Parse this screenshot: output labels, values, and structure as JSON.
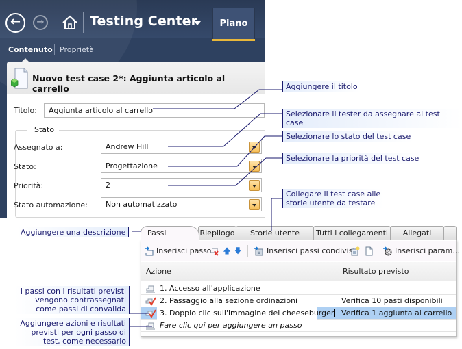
{
  "header": {
    "app_title": "Testing Center",
    "active_tab": "Piano",
    "subnav": {
      "active": "Contenuto",
      "inactive": "Proprietà"
    }
  },
  "work_item": {
    "title": "Nuovo test case 2*: Aggiunta articolo al carrello",
    "title_label": "Titolo:",
    "title_value": "Aggiunta articolo al carrello",
    "group_label": "Stato",
    "fields": [
      {
        "label": "Assegnato a:",
        "value": "Andrew Hill"
      },
      {
        "label": "Stato:",
        "value": "Progettazione"
      },
      {
        "label": "Priorità:",
        "value": "2"
      },
      {
        "label": "Stato automazione:",
        "value": "Non automatizzato"
      }
    ]
  },
  "steps_panel": {
    "tabs": [
      "Passi",
      "Riepilogo",
      "Storie utente testate",
      "Tutti i collegamenti",
      "Allegati",
      ""
    ],
    "active_tab": "Passi",
    "toolbar": {
      "insert_step": "Inserisci passo",
      "insert_shared_steps": "Inserisci passi condivisi",
      "insert_parameter": "Inserisci param..."
    },
    "columns": [
      "Azione",
      "Risultato previsto"
    ],
    "rows": [
      {
        "action": "1. Accesso all'applicazione",
        "expected": "",
        "icon": "step-icon",
        "selected": false
      },
      {
        "action": "2. Passaggio alla sezione ordinazioni",
        "expected": "Verifica 10 pasti disponibili",
        "icon": "validation-step-icon",
        "selected": false
      },
      {
        "action": "3. Doppio clic sull'immagine del cheeseburger",
        "expected": "Verifica 1 aggiunta al carrello",
        "icon": "validation-step-icon",
        "selected": true
      }
    ],
    "new_row_hint": "Fare clic qui per aggiungere un passo"
  },
  "callouts": {
    "add_title": "Aggiungere il titolo",
    "select_tester": "Selezionare il tester da assegnare al test case",
    "select_state": "Selezionare lo stato del test case",
    "select_priority": "Selezionare la priorità del test case",
    "link_stories_1": "Collegare il test case alle",
    "link_stories_2": "storie utente da testare",
    "add_description": "Aggiungere una descrizione",
    "validation_1": "I passi con i risultati previsti",
    "validation_2": "vengono contrassegnati",
    "validation_3": "come passi di convalida",
    "add_actions_1": "Aggiungere azioni e risultati",
    "add_actions_2": "previsti per ogni passo di",
    "add_actions_3": "test, come necessario"
  },
  "colors": {
    "header_bg": "#2e4160",
    "active_tab_underline": "#e8b73a",
    "selected_row": "#aed0f3",
    "callout_text": "#1a1a6e"
  }
}
